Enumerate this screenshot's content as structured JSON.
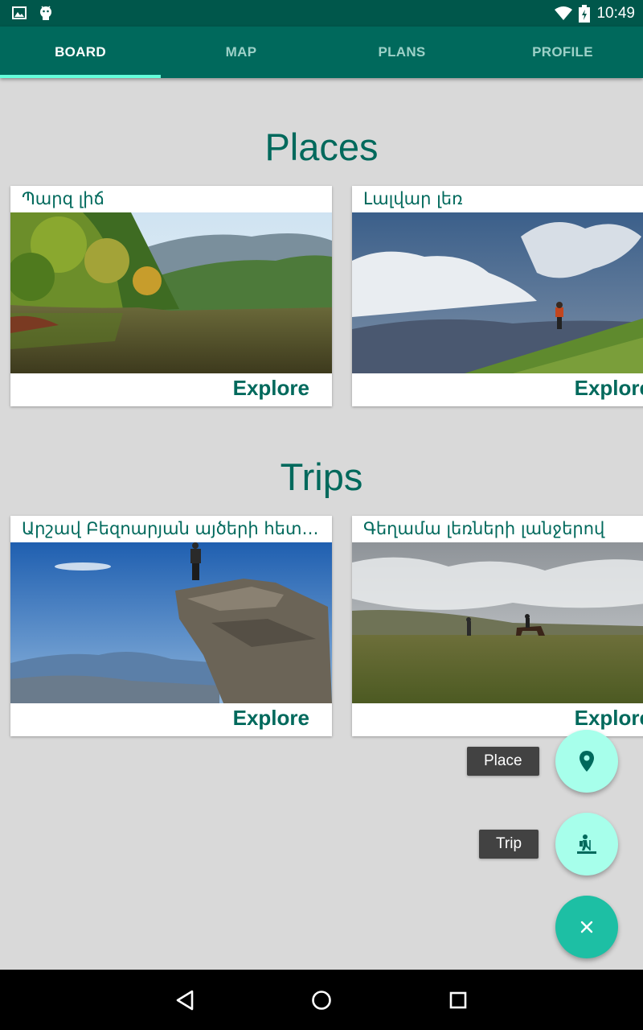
{
  "status_bar": {
    "time": "10:49",
    "icons_left": [
      "image-icon",
      "android-icon"
    ],
    "icons_right": [
      "wifi-icon",
      "battery-icon"
    ]
  },
  "tabs": [
    {
      "label": "BOARD",
      "active": true
    },
    {
      "label": "MAP",
      "active": false
    },
    {
      "label": "PLANS",
      "active": false
    },
    {
      "label": "PROFILE",
      "active": false
    }
  ],
  "places": {
    "title": "Places",
    "cards": [
      {
        "title": "Պարզ լիճ",
        "action": "Explore"
      },
      {
        "title": "Լալվար լեռ",
        "action": "Explore"
      }
    ]
  },
  "trips": {
    "title": "Trips",
    "cards": [
      {
        "title": "Արշավ Բեզոարյան այծերի հետքերով",
        "action": "Explore"
      },
      {
        "title": "Գեղամա լեռների լանջերով",
        "action": "Explore"
      }
    ]
  },
  "fab_menu": {
    "place_label": "Place",
    "trip_label": "Trip",
    "place_icon": "location-pin-icon",
    "trip_icon": "hiker-icon",
    "main_icon": "close-icon"
  },
  "colors": {
    "status_bar": "#00574b",
    "primary": "#00695c",
    "accent": "#64ffda",
    "fab_mini": "#a7ffeb",
    "fab_main": "#1dbfa4",
    "background": "#d9d9d9"
  }
}
